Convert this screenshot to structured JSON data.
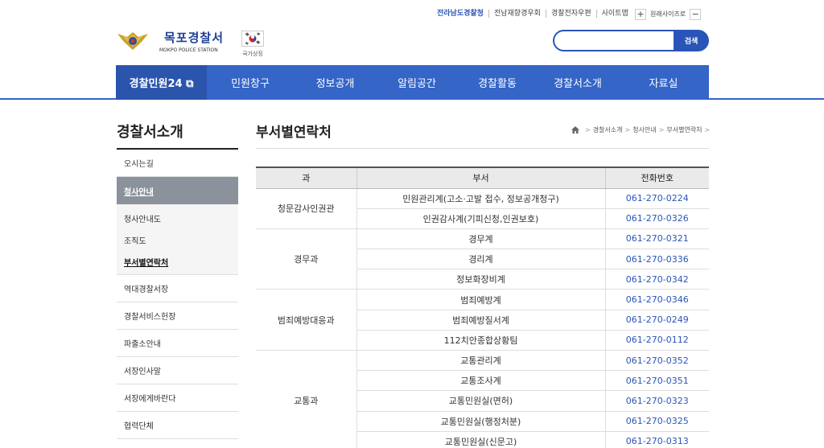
{
  "top_links": [
    "전라남도경찰청",
    "전남재향경우회",
    "경찰전자우편",
    "사이트맵"
  ],
  "zoom": {
    "plus": "+",
    "label": "원래사이즈로",
    "minus": "−"
  },
  "logo": {
    "name_kr": "목포경찰서",
    "name_en": "MOKPO POLICE STATION"
  },
  "symbol_label": "국가상징",
  "search": {
    "placeholder": "",
    "value": "",
    "button": "검색"
  },
  "gnb": [
    "경찰민원24 ⧉",
    "민원창구",
    "정보공개",
    "알림공간",
    "경찰활동",
    "경찰서소개",
    "자료실"
  ],
  "lnb": {
    "title": "경찰서소개",
    "items": [
      {
        "label": "오시는길"
      },
      {
        "label": "청사안내",
        "active": true,
        "sub": [
          "청사안내도",
          "조직도",
          "부서별연락처"
        ]
      },
      {
        "label": "역대경찰서장"
      },
      {
        "label": "경찰서비스헌장"
      },
      {
        "label": "파출소안내"
      },
      {
        "label": "서장인사말"
      },
      {
        "label": "서장에게바란다"
      },
      {
        "label": "협력단체"
      }
    ]
  },
  "content": {
    "title": "부서별연락처",
    "breadcrumb": [
      "경찰서소개",
      "청사안내",
      "부서별연락처"
    ],
    "table": {
      "headers": [
        "과",
        "부서",
        "전화번호"
      ],
      "groups": [
        {
          "name": "청문감사인권관",
          "rows": [
            {
              "dept": "민원관리계(고소·고발 접수, 정보공개청구)",
              "tel": "061-270-0224"
            },
            {
              "dept": "인권감사계(기피신청,인권보호)",
              "tel": "061-270-0326"
            }
          ]
        },
        {
          "name": "경무과",
          "rows": [
            {
              "dept": "경무계",
              "tel": "061-270-0321"
            },
            {
              "dept": "경리계",
              "tel": "061-270-0336"
            },
            {
              "dept": "정보화장비계",
              "tel": "061-270-0342"
            }
          ]
        },
        {
          "name": "범죄예방대응과",
          "rows": [
            {
              "dept": "범죄예방계",
              "tel": "061-270-0346"
            },
            {
              "dept": "범죄예방질서계",
              "tel": "061-270-0249"
            },
            {
              "dept": "112치안종합상황팀",
              "tel": "061-270-0112"
            }
          ]
        },
        {
          "name": "교통과",
          "rows": [
            {
              "dept": "교통관리계",
              "tel": "061-270-0352"
            },
            {
              "dept": "교통조사계",
              "tel": "061-270-0351"
            },
            {
              "dept": "교통민원실(면허)",
              "tel": "061-270-0323"
            },
            {
              "dept": "교통민원실(행정처분)",
              "tel": "061-270-0325"
            },
            {
              "dept": "교통민원실(신문고)",
              "tel": "061-270-0313"
            }
          ]
        }
      ]
    }
  },
  "colors": {
    "brand": "#3465c7",
    "brand_dark": "#2b54ad",
    "link": "#2a55b8",
    "lnb_active": "#8b929b"
  }
}
